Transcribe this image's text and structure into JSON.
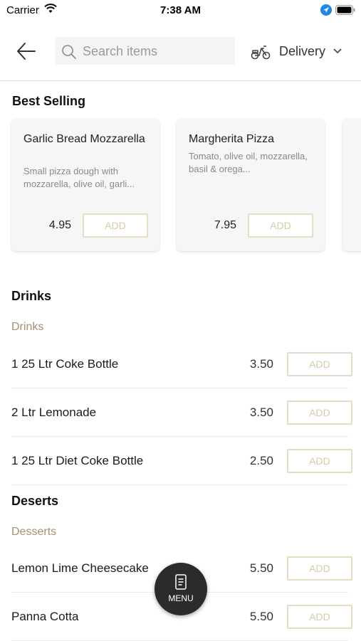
{
  "status": {
    "carrier": "Carrier",
    "time": "7:38 AM"
  },
  "search": {
    "placeholder": "Search items"
  },
  "delivery": {
    "label": "Delivery"
  },
  "best_selling": {
    "title": "Best Selling",
    "items": [
      {
        "name": "Garlic Bread Mozzarella",
        "description": "Small pizza dough with mozzarella, olive oil, garli...",
        "price": "4.95",
        "add_label": "ADD"
      },
      {
        "name": "Margherita Pizza",
        "description": "Tomato, olive oil, mozzarella, basil & orega...",
        "price": "7.95",
        "add_label": "ADD"
      }
    ]
  },
  "drinks": {
    "title": "Drinks",
    "subcategory": "Drinks",
    "items": [
      {
        "name": "1 25 Ltr Coke Bottle",
        "price": "3.50",
        "add_label": "ADD"
      },
      {
        "name": "2 Ltr Lemonade",
        "price": "3.50",
        "add_label": "ADD"
      },
      {
        "name": "1 25 Ltr Diet Coke Bottle",
        "price": "2.50",
        "add_label": "ADD"
      }
    ]
  },
  "deserts": {
    "title": "Deserts",
    "subcategory": "Desserts",
    "items": [
      {
        "name": "Lemon Lime Cheesecake",
        "price": "5.50",
        "add_label": "ADD"
      },
      {
        "name": "Panna Cotta",
        "price": "5.50",
        "add_label": "ADD"
      }
    ]
  },
  "menu_button": {
    "label": "MENU"
  },
  "colors": {
    "accent": "#a39370",
    "add_border": "#e4dcc3",
    "fab": "#2b2b2b"
  }
}
